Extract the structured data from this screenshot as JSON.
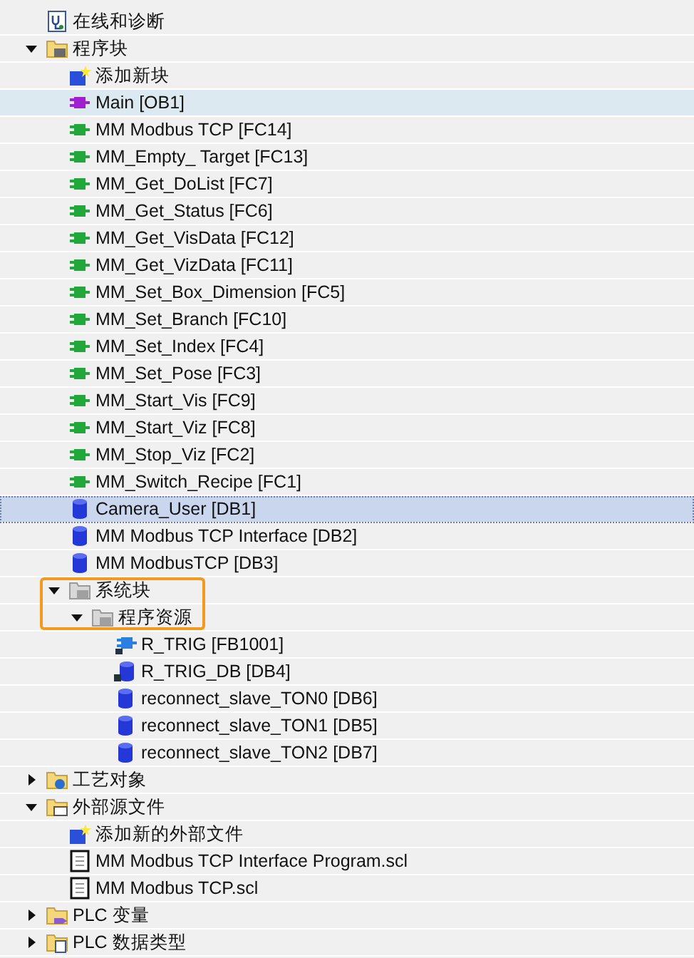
{
  "tree": [
    {
      "label": "在线和诊断",
      "kind": "diagnostics",
      "selected": false,
      "hovered": false
    },
    {
      "label": "程序块",
      "kind": "folder-block",
      "expanded": true,
      "selected": false,
      "hovered": false,
      "children": [
        {
          "label": "添加新块",
          "kind": "add",
          "selected": false,
          "hovered": false
        },
        {
          "label": "Main [OB1]",
          "kind": "ob",
          "selected": false,
          "hovered": true
        },
        {
          "label": "MM Modbus TCP [FC14]",
          "kind": "fc",
          "selected": false,
          "hovered": false
        },
        {
          "label": "MM_Empty_ Target [FC13]",
          "kind": "fc",
          "selected": false,
          "hovered": false
        },
        {
          "label": "MM_Get_DoList [FC7]",
          "kind": "fc",
          "selected": false,
          "hovered": false
        },
        {
          "label": "MM_Get_Status [FC6]",
          "kind": "fc",
          "selected": false,
          "hovered": false
        },
        {
          "label": "MM_Get_VisData [FC12]",
          "kind": "fc",
          "selected": false,
          "hovered": false
        },
        {
          "label": "MM_Get_VizData [FC11]",
          "kind": "fc",
          "selected": false,
          "hovered": false
        },
        {
          "label": "MM_Set_Box_Dimension [FC5]",
          "kind": "fc",
          "selected": false,
          "hovered": false
        },
        {
          "label": "MM_Set_Branch [FC10]",
          "kind": "fc",
          "selected": false,
          "hovered": false
        },
        {
          "label": "MM_Set_Index [FC4]",
          "kind": "fc",
          "selected": false,
          "hovered": false
        },
        {
          "label": "MM_Set_Pose [FC3]",
          "kind": "fc",
          "selected": false,
          "hovered": false
        },
        {
          "label": "MM_Start_Vis [FC9]",
          "kind": "fc",
          "selected": false,
          "hovered": false
        },
        {
          "label": "MM_Start_Viz [FC8]",
          "kind": "fc",
          "selected": false,
          "hovered": false
        },
        {
          "label": "MM_Stop_Viz [FC2]",
          "kind": "fc",
          "selected": false,
          "hovered": false
        },
        {
          "label": "MM_Switch_Recipe [FC1]",
          "kind": "fc",
          "selected": false,
          "hovered": false
        },
        {
          "label": "Camera_User [DB1]",
          "kind": "db",
          "selected": true,
          "hovered": false
        },
        {
          "label": "MM Modbus TCP Interface [DB2]",
          "kind": "db",
          "selected": false,
          "hovered": false
        },
        {
          "label": "MM ModbusTCP [DB3]",
          "kind": "db",
          "selected": false,
          "hovered": false
        },
        {
          "label": "系统块",
          "kind": "folder-system",
          "expanded": true,
          "highlighted": true,
          "selected": false,
          "hovered": false,
          "children": [
            {
              "label": "程序资源",
              "kind": "folder-system",
              "expanded": true,
              "highlighted": true,
              "selected": false,
              "hovered": false,
              "children": [
                {
                  "label": "R_TRIG [FB1001]",
                  "kind": "fb",
                  "selected": false,
                  "hovered": false
                },
                {
                  "label": "R_TRIG_DB [DB4]",
                  "kind": "db-locked",
                  "selected": false,
                  "hovered": false
                },
                {
                  "label": "reconnect_slave_TON0 [DB6]",
                  "kind": "db",
                  "selected": false,
                  "hovered": false
                },
                {
                  "label": "reconnect_slave_TON1 [DB5]",
                  "kind": "db",
                  "selected": false,
                  "hovered": false
                },
                {
                  "label": "reconnect_slave_TON2 [DB7]",
                  "kind": "db",
                  "selected": false,
                  "hovered": false
                }
              ]
            }
          ]
        }
      ]
    },
    {
      "label": "工艺对象",
      "kind": "folder-tech",
      "expanded": false,
      "selected": false,
      "hovered": false
    },
    {
      "label": "外部源文件",
      "kind": "folder-ext",
      "expanded": true,
      "selected": false,
      "hovered": false,
      "children": [
        {
          "label": "添加新的外部文件",
          "kind": "add",
          "selected": false,
          "hovered": false
        },
        {
          "label": "MM Modbus TCP Interface Program.scl",
          "kind": "file",
          "selected": false,
          "hovered": false
        },
        {
          "label": "MM Modbus TCP.scl",
          "kind": "file",
          "selected": false,
          "hovered": false
        }
      ]
    },
    {
      "label": "PLC 变量",
      "kind": "folder-tag",
      "expanded": false,
      "selected": false,
      "hovered": false
    },
    {
      "label": "PLC 数据类型",
      "kind": "folder-type",
      "expanded": false,
      "selected": false,
      "hovered": false
    }
  ]
}
